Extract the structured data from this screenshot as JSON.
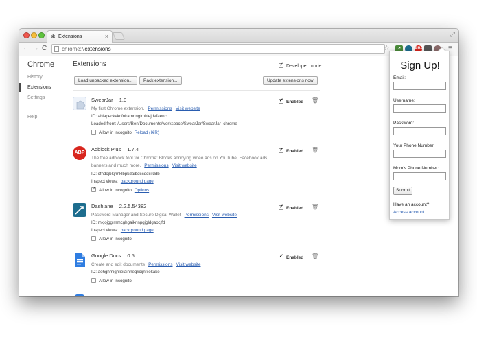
{
  "browser": {
    "tab_title": "Extensions",
    "tab_close": "×",
    "url_scheme": "chrome://",
    "url_path": "extensions"
  },
  "sidebar": {
    "title": "Chrome",
    "items": [
      {
        "label": "History"
      },
      {
        "label": "Extensions"
      },
      {
        "label": "Settings"
      },
      {
        "label": "Help"
      }
    ]
  },
  "main": {
    "title": "Extensions",
    "developer_mode": "Developer mode",
    "buttons": {
      "load_unpacked": "Load unpacked extension...",
      "pack": "Pack extension...",
      "update": "Update extensions now"
    },
    "enabled_label": "Enabled",
    "extensions": [
      {
        "name": "SwearJar",
        "version": "1.0",
        "description": "My first Chrome extension.",
        "permissions": "Permissions",
        "visit": "Visit website",
        "id": "ID: ablapeckekcfnkamnngfmhiejdefaenc",
        "loaded_from": "Loaded from: /Users/Ben/Documents/workspace/SwearJar/SwearJar_chrome",
        "incognito": "Allow in incognito",
        "extra_link": "Reload (⌘R)"
      },
      {
        "name": "Adblock Plus",
        "version": "1.7.4",
        "description": "The free adblock tool for Chrome: Blocks annoying video ads on YouTube, Facebook ads, banners and much more.",
        "permissions": "Permissions",
        "visit": "Visit website",
        "id": "ID: cfhdojbkjhnklbpkdaibdccddilifddb",
        "inspect": "Inspect views:",
        "inspect_link": "background page",
        "incognito": "Allow in incognito",
        "extra_link": "Options",
        "logo_text": "ABP"
      },
      {
        "name": "Dashlane",
        "version": "2.2.5.54382",
        "description": "Password Manager and Secure Digital Wallet",
        "permissions": "Permissions",
        "visit": "Visit website",
        "id": "ID: mkjojgglmmcghgaiknnpgjgldgaocjfd",
        "inspect": "Inspect views:",
        "inspect_link": "background page",
        "incognito": "Allow in incognito"
      },
      {
        "name": "Google Docs",
        "version": "0.5",
        "description": "Create and edit documents",
        "permissions": "Permissions",
        "visit": "Visit website",
        "id": "ID: aohghmighlieiainnegkcijnfilokake",
        "incognito": "Allow in incognito"
      }
    ]
  },
  "popup": {
    "title": "Sign Up!",
    "email": "Email:",
    "username": "Username:",
    "password": "Password:",
    "your_phone": "Your Phone Number:",
    "moms_phone": "Mom's Phone Number:",
    "submit": "Submit",
    "have_account": "Have an account?",
    "access": "Access account"
  },
  "colors": {
    "link": "#2a5db0",
    "abp_red": "#d8261e",
    "dashlane_blue": "#1d6d8e",
    "docs_blue": "#2f7de1"
  }
}
